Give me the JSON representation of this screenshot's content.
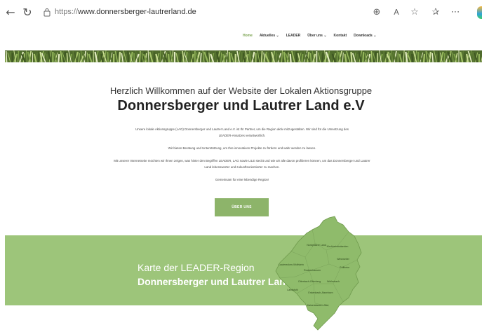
{
  "browser": {
    "url_scheme": "https://",
    "url_host": "www.donnersberger-lautrerland.de",
    "icons": [
      "back-arrow-icon",
      "reload-icon",
      "lock-icon",
      "zoom-icon",
      "read-aloud-icon",
      "favorite-star-icon",
      "favorites-icon",
      "more-icon",
      "copilot-icon"
    ]
  },
  "site_nav": {
    "items": [
      "Home",
      "Aktuelles ⌄",
      "LEADER",
      "Über uns ⌄",
      "Kontakt",
      "Downloads ⌄"
    ],
    "active_index": 0
  },
  "intro": {
    "title": "Herzlich Willkommen auf der Website der Lokalen Aktionsgruppe",
    "org": "Donnersberger und Lautrer Land e.V",
    "paragraph_1": "Unsere lokale Aktionsgruppe (LAG) Donnersberger und Lautrer Land e.V. ist Ihr Partner, um die Region aktiv mitzugestalten. Wir sind für die Umsetzung des LEADER-Ansatzes verantwortlich.",
    "paragraph_2": "Wir bieten Beratung und Unterstützung, um Ihre innovativen Projekte zu fördern und wahr werden zu lassen.",
    "paragraph_3": "Mit unserer Internetseite möchten wir Ihnen zeigen, was hinter den Begriffen LEADER, LAG sowie LILE steckt und wie wir alle davon profitieren können, um das Donnersberger und Lautrer Land lebenswerter und zukunftsorientierter zu machen.",
    "paragraph_4": "Gemeinsam für eine lebendige Region!",
    "button_label": "ÜBER UNS"
  },
  "map_section": {
    "title": "Karte der LEADER-Region",
    "org": "Donnersberger und Lautrer Land",
    "region_labels": [
      "Nordpfälzer Land",
      "Kirchheimbolanden",
      "Winnweiler",
      "Göllheim",
      "Lauterecken-Wolfstein",
      "Rockenhausen",
      "Otterbach-Otterberg",
      "Weilerbach",
      "Enkenbach-Alsenborn",
      "Landstuhl",
      "Kaiserslautern-Süd"
    ]
  },
  "colors": {
    "accent_green": "#8db46a",
    "band_green": "#9dc57a",
    "map_fill": "#8fbb6b",
    "nav_active": "#7aa34f"
  }
}
